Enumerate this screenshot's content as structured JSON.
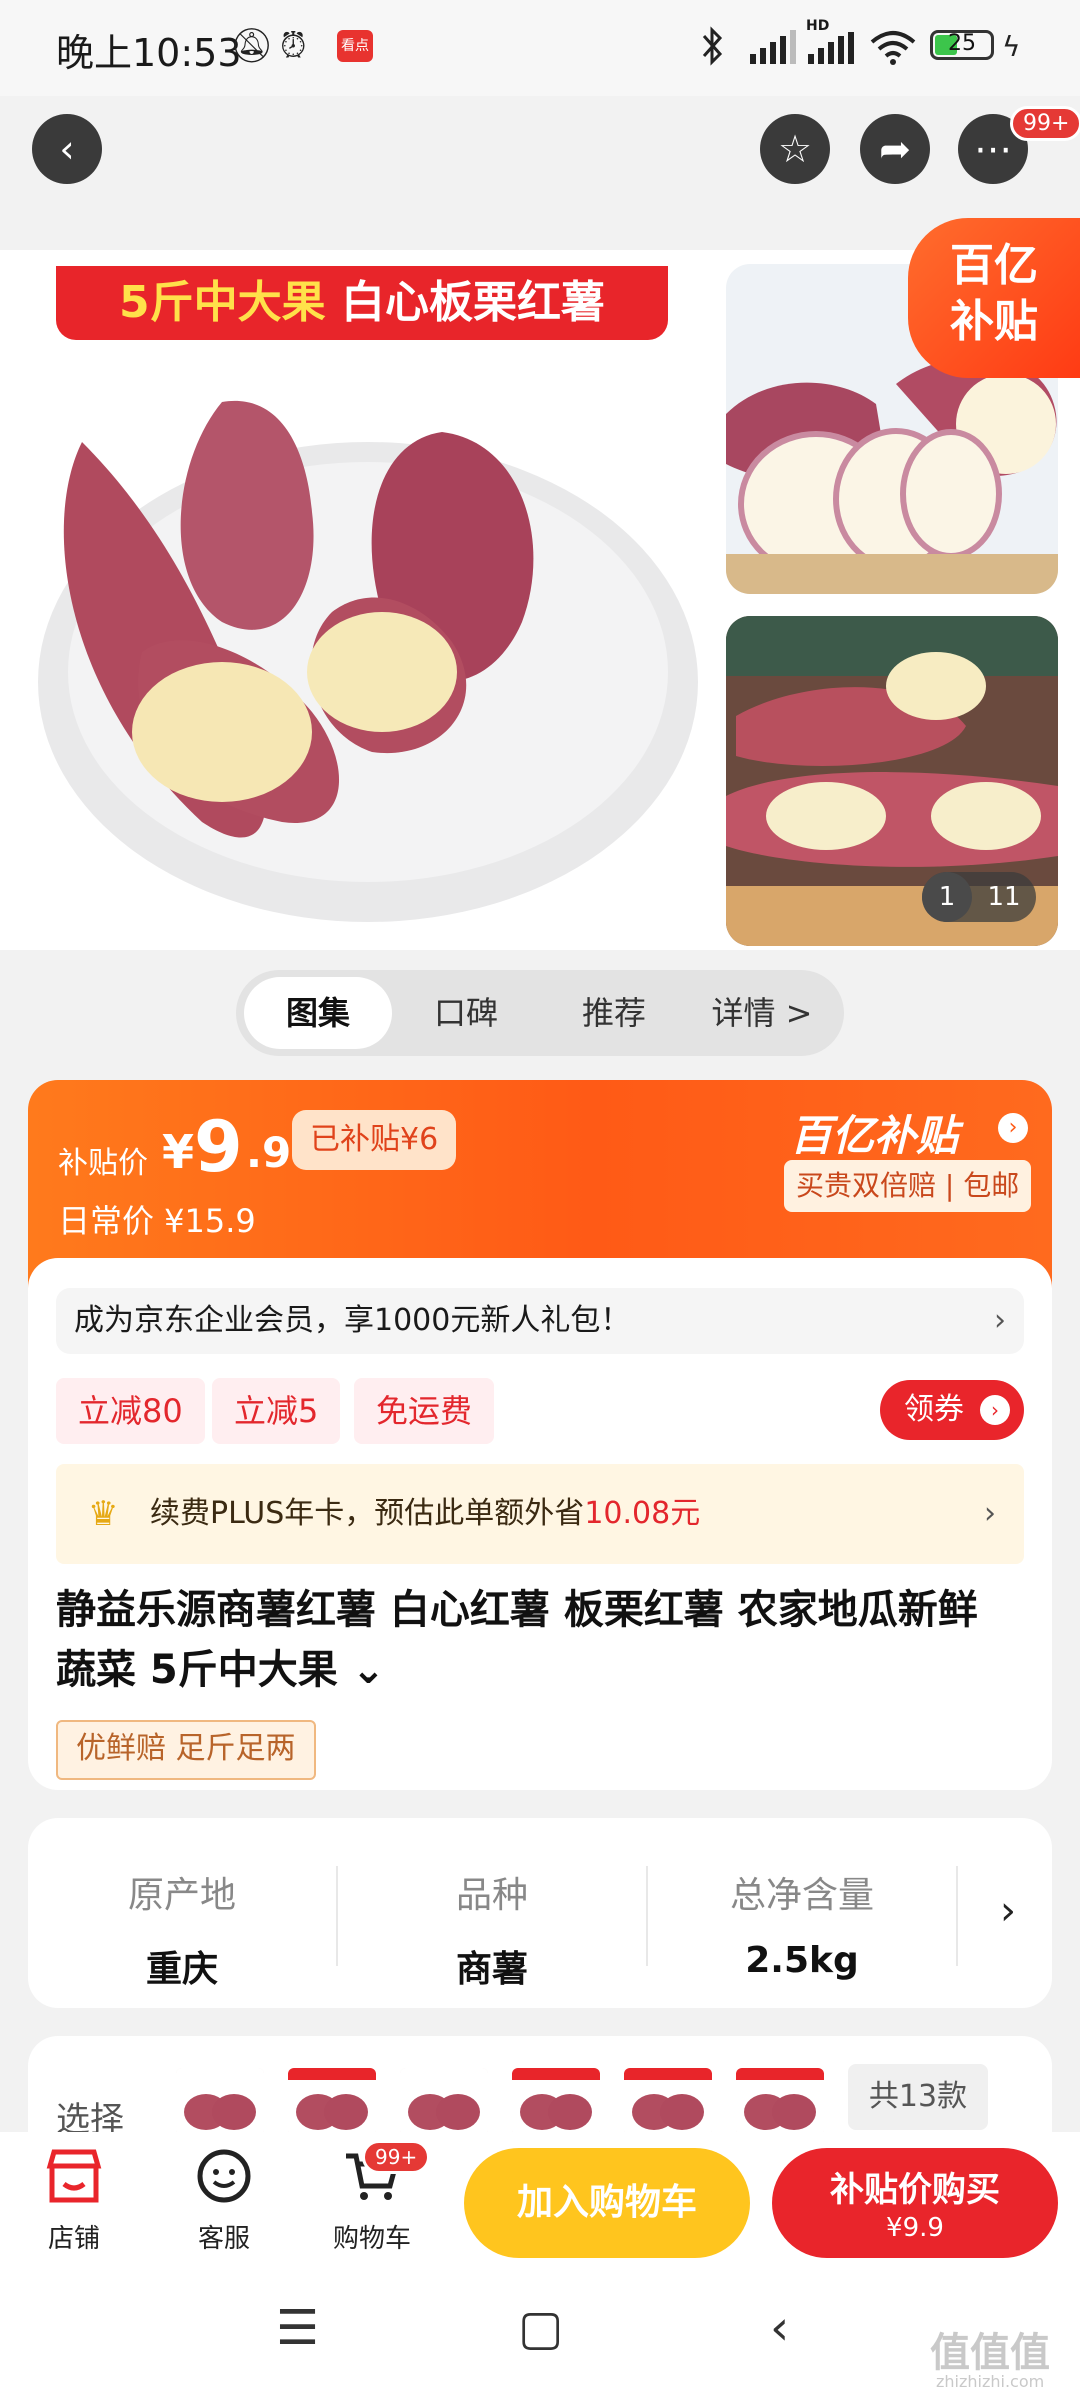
{
  "status": {
    "time": "晚上10:53",
    "news_badge": "看点",
    "hd": "HD",
    "battery": "25"
  },
  "header": {
    "cart_badge": "99+"
  },
  "banner": {
    "part1": "5斤中大果",
    "part2": "白心板栗红薯"
  },
  "yi_badge": {
    "line1": "百亿",
    "line2": "补贴"
  },
  "gallery_counter": {
    "current": "1",
    "total": "11"
  },
  "tabs": [
    {
      "label": "图集"
    },
    {
      "label": "口碑"
    },
    {
      "label": "推荐"
    },
    {
      "label": "详情 >"
    }
  ],
  "price": {
    "label": "补贴价",
    "yen": "¥",
    "int": "9",
    "dec": ".9",
    "subsidized": "已补贴¥6",
    "daily": "日常价 ¥15.9",
    "program": "百亿补贴",
    "program_tags": "买贵双倍赔 | 包邮"
  },
  "member_banner": {
    "text": "成为京东企业会员，享1000元新人礼包！",
    "chevron": "›"
  },
  "coupons": [
    "立减80",
    "立减5",
    "免运费"
  ],
  "get_coupon": "领券",
  "plus": {
    "text_pre": "续费PLUS年卡，预估此单额外省",
    "amount": "10.08元",
    "chevron": "›"
  },
  "product": {
    "title": "静益乐源商薯红薯 白心红薯 板栗红薯 农家地瓜新鲜蔬菜 5斤中大果 ⌄",
    "tags": "优鲜赔 足斤足两"
  },
  "attributes": [
    {
      "key": "原产地",
      "value": "重庆"
    },
    {
      "key": "品种",
      "value": "商薯"
    },
    {
      "key": "总净含量",
      "value": "2.5kg"
    }
  ],
  "choose": {
    "label": "选择",
    "count": "共13款"
  },
  "bottom": {
    "shop": "店铺",
    "service": "客服",
    "cart": "购物车",
    "cart_badge": "99+",
    "add_to_cart": "加入购物车",
    "buy_main": "补贴价购买",
    "buy_price": "¥9.9"
  },
  "watermark": {
    "main": "值值值",
    "url": "zhizhizhi.com"
  },
  "colors": {
    "brand_red": "#e9252b",
    "orange": "#ff5a16",
    "yellow_button": "#ffc51e"
  }
}
